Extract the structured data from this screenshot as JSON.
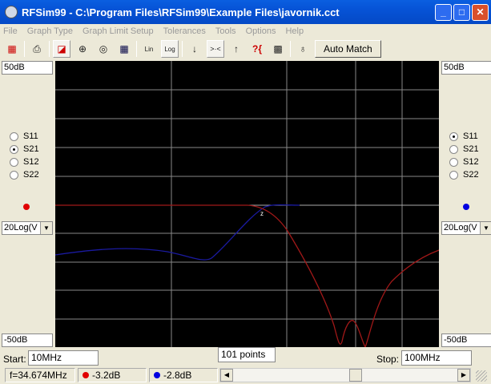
{
  "window": {
    "title": "RFSim99 - C:\\Program Files\\RFSim99\\Example Files\\javornik.cct"
  },
  "menu": [
    "File",
    "Graph Type",
    "Graph Limit Setup",
    "Tolerances",
    "Tools",
    "Options",
    "Help"
  ],
  "toolbar": {
    "auto_match": "Auto Match",
    "lin": "Lin",
    "log": "Log"
  },
  "left_panel": {
    "top_limit": "50dB",
    "bottom_limit": "-50dB",
    "params": [
      "S11",
      "S21",
      "S12",
      "S22"
    ],
    "selected": "S21",
    "trace_color": "#e00000",
    "format": "20Log(V"
  },
  "right_panel": {
    "top_limit": "50dB",
    "bottom_limit": "-50dB",
    "params": [
      "S11",
      "S21",
      "S12",
      "S22"
    ],
    "selected": "S11",
    "trace_color": "#0000e0",
    "format": "20Log(V"
  },
  "sweep": {
    "start_label": "Start:",
    "start": "10MHz",
    "points": "101 points",
    "stop_label": "Stop:",
    "stop": "100MHz"
  },
  "status": {
    "freq": "f=34.674MHz",
    "red_value": "-3.2dB",
    "blue_value": "-2.8dB"
  },
  "colors": {
    "red": "#e00000",
    "blue": "#0000e0"
  }
}
